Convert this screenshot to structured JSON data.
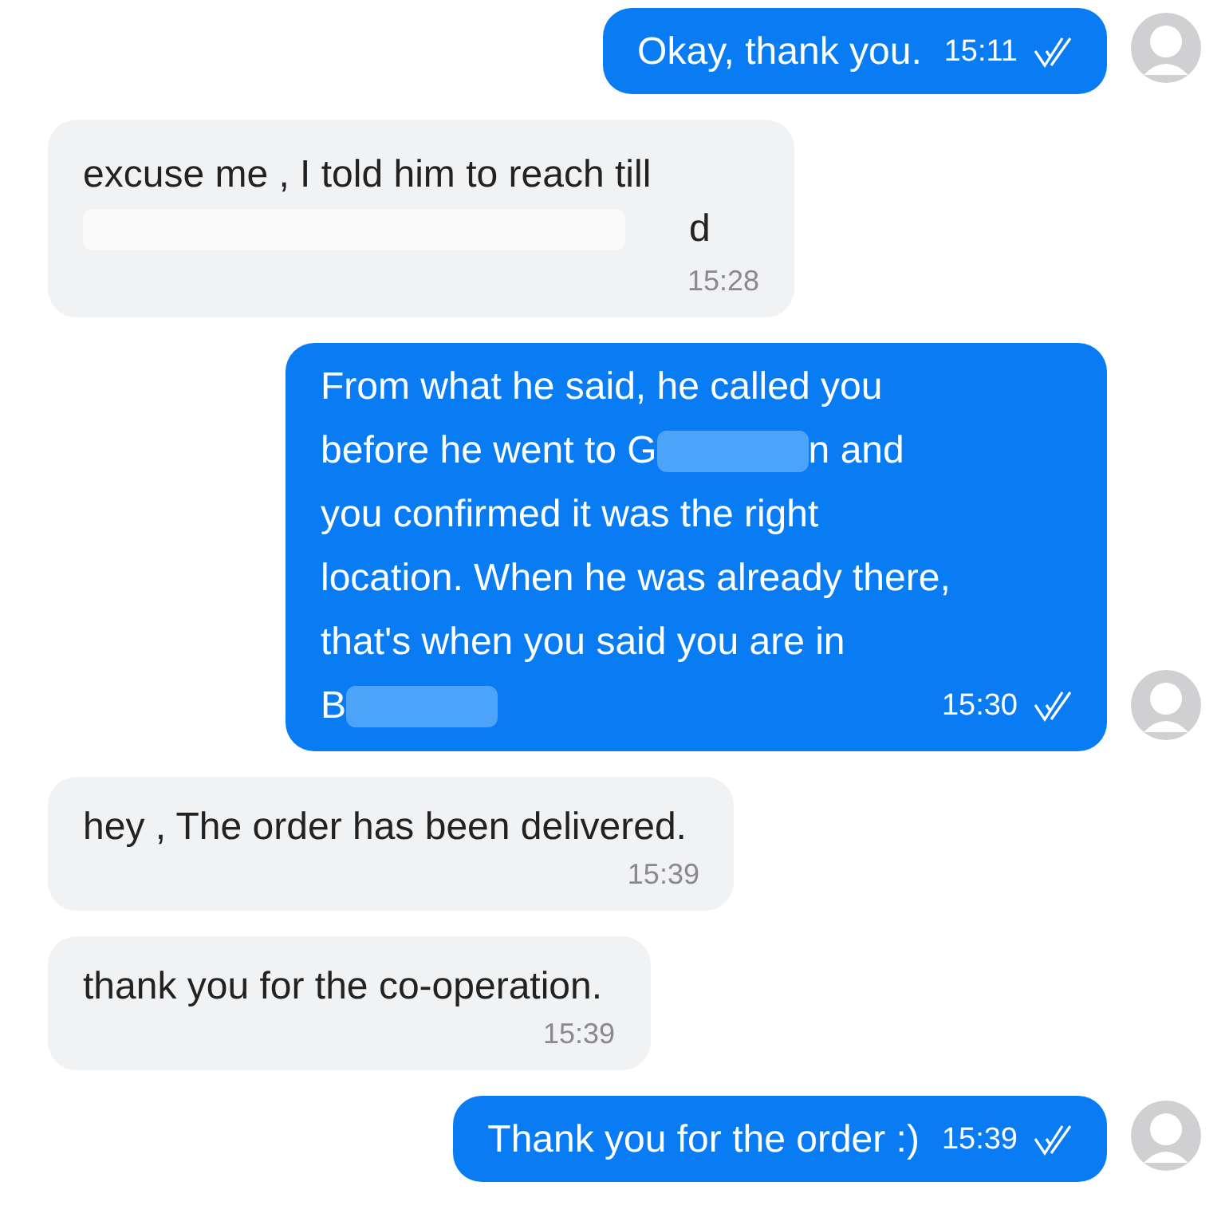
{
  "messages": [
    {
      "kind": "sent",
      "lines": [
        [
          {
            "kind": "text",
            "text": "Okay, thank you."
          }
        ]
      ],
      "time": "15:11",
      "read": true
    },
    {
      "kind": "received",
      "lines": [
        [
          {
            "kind": "text",
            "text": "excuse me , I told him to reach till"
          }
        ],
        [
          {
            "kind": "redaction"
          },
          {
            "kind": "text",
            "text": "d"
          }
        ]
      ],
      "time": "15:28"
    },
    {
      "kind": "sent",
      "lines": [
        [
          {
            "kind": "text",
            "text": "From what he said, he called you"
          }
        ],
        [
          {
            "kind": "text",
            "text": "before he went to G"
          },
          {
            "kind": "redaction"
          },
          {
            "kind": "text",
            "text": "n and"
          }
        ],
        [
          {
            "kind": "text",
            "text": "you confirmed it was the right"
          }
        ],
        [
          {
            "kind": "text",
            "text": "location. When he was already there,"
          }
        ],
        [
          {
            "kind": "text",
            "text": "that's when you said you are in"
          }
        ],
        [
          {
            "kind": "text",
            "text": "B"
          },
          {
            "kind": "redaction"
          }
        ]
      ],
      "time": "15:30",
      "read": true
    },
    {
      "kind": "received",
      "lines": [
        [
          {
            "kind": "text",
            "text": "hey , The order has been delivered."
          }
        ]
      ],
      "time": "15:39"
    },
    {
      "kind": "received",
      "lines": [
        [
          {
            "kind": "text",
            "text": "thank you for the co-operation."
          }
        ]
      ],
      "time": "15:39"
    },
    {
      "kind": "sent",
      "lines": [
        [
          {
            "kind": "text",
            "text": "Thank you for the order :)"
          }
        ]
      ],
      "time": "15:39",
      "read": true
    }
  ]
}
